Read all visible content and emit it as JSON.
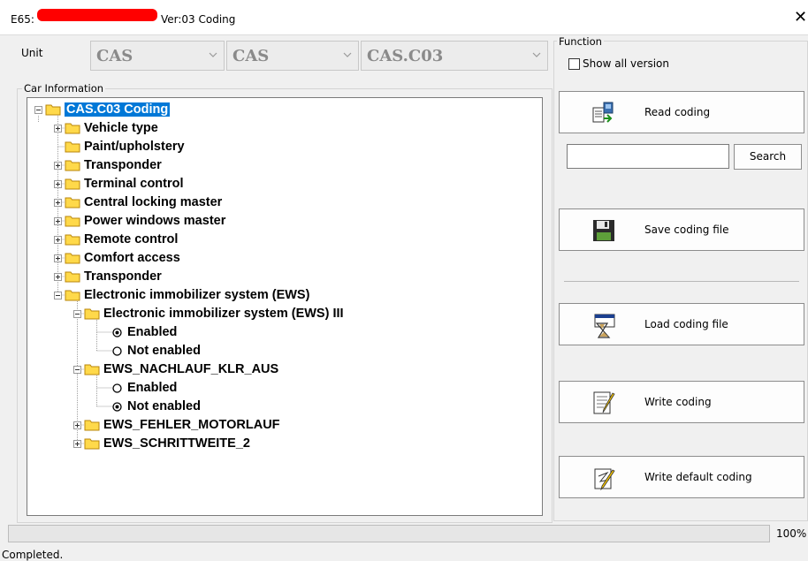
{
  "window": {
    "title_prefix": "E65:",
    "title_version": "Ver:03 Coding"
  },
  "unit": {
    "label": "Unit",
    "combos": [
      "CAS",
      "CAS",
      "CAS.C03"
    ]
  },
  "car_information": {
    "label": "Car Information",
    "root": "CAS.C03 Coding",
    "items": [
      "Vehicle type",
      "Paint/upholstery",
      "Transponder",
      "Terminal control",
      "Central locking master",
      "Power windows master",
      "Remote control",
      "Comfort access",
      "Transponder",
      "Electronic immobilizer system (EWS)"
    ],
    "ews_children": [
      {
        "label": "Electronic immobilizer system (EWS) III",
        "options": [
          {
            "label": "Enabled",
            "selected": true
          },
          {
            "label": "Not enabled",
            "selected": false
          }
        ]
      },
      {
        "label": "EWS_NACHLAUF_KLR_AUS",
        "options": [
          {
            "label": "Enabled",
            "selected": false
          },
          {
            "label": "Not enabled",
            "selected": true
          }
        ]
      },
      {
        "label": "EWS_FEHLER_MOTORLAUF"
      },
      {
        "label": "EWS_SCHRITTWEITE_2"
      }
    ]
  },
  "function": {
    "label": "Function",
    "show_all_version": "Show all version",
    "read_coding": "Read coding",
    "search_placeholder": "",
    "search_button": "Search",
    "save_coding_file": "Save coding file",
    "load_coding_file": "Load coding file",
    "write_coding": "Write coding",
    "write_default_coding": "Write default coding"
  },
  "status": {
    "progress": "100%",
    "progress_value": 1.0,
    "message": "Completed."
  },
  "colors": {
    "selection": "#0078d7",
    "folder": "#ffd94a",
    "redaction": "#ff0000"
  }
}
